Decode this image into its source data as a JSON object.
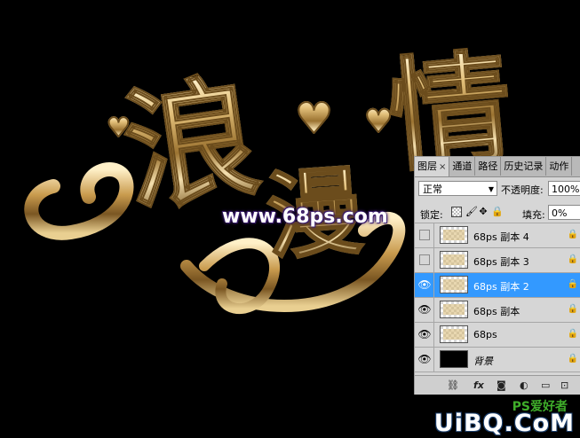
{
  "artwork": {
    "chars": [
      "浪",
      "漫",
      "情"
    ],
    "watermark": "www.68ps.com",
    "brand": {
      "small": "PS爱好者",
      "main": "UiBQ.CoM"
    },
    "colors": {
      "gold": "#d9b26a",
      "watermark_glow": "#3b1d6e"
    }
  },
  "panel": {
    "tabs": [
      {
        "label": "图层",
        "active": true,
        "close": "×"
      },
      {
        "label": "通道",
        "active": false
      },
      {
        "label": "路径",
        "active": false
      },
      {
        "label": "历史记录",
        "active": false
      },
      {
        "label": "动作",
        "active": false
      }
    ],
    "blend_mode": "正常",
    "opacity_label": "不透明度:",
    "opacity_value": "100%",
    "lock_label": "锁定:",
    "fill_label": "填充:",
    "fill_value": "0%",
    "layers": [
      {
        "name": "68ps 副本 4",
        "visible": false,
        "selected": false,
        "locked": true
      },
      {
        "name": "68ps 副本 3",
        "visible": false,
        "selected": false,
        "locked": true
      },
      {
        "name": "68ps 副本 2",
        "visible": true,
        "selected": true,
        "locked": true
      },
      {
        "name": "68ps  副本",
        "visible": true,
        "selected": false,
        "locked": true
      },
      {
        "name": "68ps",
        "visible": true,
        "selected": false,
        "locked": true
      },
      {
        "name": "背景",
        "visible": true,
        "selected": false,
        "locked": true
      }
    ],
    "selected_color": "#3399ff"
  }
}
